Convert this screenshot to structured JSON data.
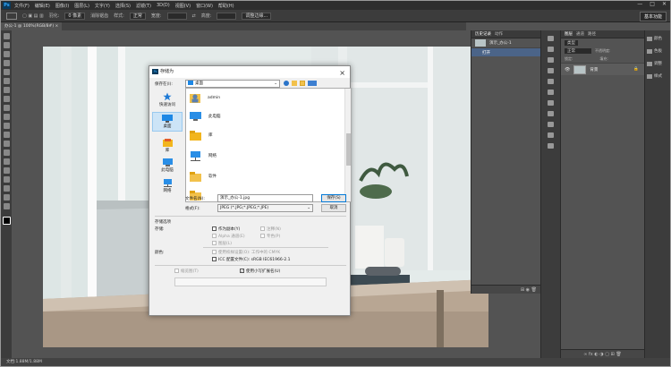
{
  "menu": {
    "logo": "Ps",
    "items": [
      "文件(F)",
      "编辑(E)",
      "图像(I)",
      "图层(L)",
      "文字(Y)",
      "选择(S)",
      "滤镜(T)",
      "3D(D)",
      "视图(V)",
      "窗口(W)",
      "帮助(H)"
    ],
    "window_controls": [
      "—",
      "□",
      "✕"
    ]
  },
  "options": {
    "feather_label": "羽化:",
    "feather_value": "0 像素",
    "antialias": "消除锯齿",
    "style_label": "样式:",
    "style_value": "正常",
    "width_label": "宽度:",
    "height_label": "高度:",
    "refine_edge": "调整边缘...",
    "workspace": "基本功能"
  },
  "doc_tab": "办公-1 @ 100%(RGB/8#) ×",
  "status": "文档:1.88M/1.88M",
  "history_panel": {
    "tabs": [
      "历史记录",
      "动作"
    ],
    "snapshot": "演示_办公-1",
    "step": "打开"
  },
  "layers_panel": {
    "tabs": [
      "图层",
      "通道",
      "路径"
    ],
    "kind_label": "类型",
    "blend": "正常",
    "opacity_label": "不透明度:",
    "lock_label": "锁定:",
    "fill_label": "填充:",
    "layer_name": "背景"
  },
  "right_strip": [
    "颜色",
    "色板",
    "调整",
    "样式"
  ],
  "dialog": {
    "title": "存储为",
    "save_in_label": "保存在(I):",
    "save_in_value": "桌面",
    "places": [
      "快速访问",
      "桌面",
      "库",
      "此电脑",
      "网络"
    ],
    "files": [
      "admin",
      "此电脑",
      "库",
      "网络",
      "软件"
    ],
    "filename_label": "文件名(N):",
    "filename_value": "演示_办公-1.jpg",
    "format_label": "格式(F):",
    "format_value": "JPEG (*.JPG;*.JPEG;*.JPE)",
    "save_button": "保存(S)",
    "cancel_button": "取消",
    "save_options_title": "存储选项",
    "save_label": "存储:",
    "as_copy": "作为副本(Y)",
    "notes": "注释(N)",
    "alpha": "Alpha 通道(E)",
    "spot": "专色(P)",
    "layers": "图层(L)",
    "color_label": "颜色:",
    "use_proof": "使用校样设置(O): 工作中的 CMYK",
    "icc": "ICC 配置文件(C): sRGB IEC61966-2.1",
    "thumbnail": "缩览图(T)",
    "lowercase_ext": "使用小写扩展名(U)"
  }
}
